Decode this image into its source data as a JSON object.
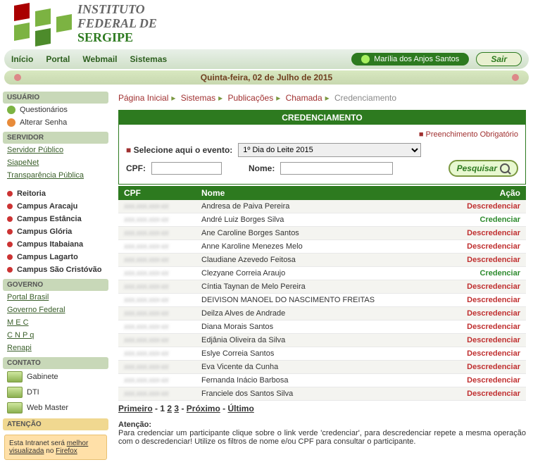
{
  "institute": {
    "line1": "INSTITUTO",
    "line2": "FEDERAL DE",
    "line3": "SERGIPE"
  },
  "topnav": {
    "inicio": "Início",
    "portal": "Portal",
    "webmail": "Webmail",
    "sistemas": "Sistemas"
  },
  "user": {
    "name": "Marília dos Anjos Santos",
    "logout": "Sair"
  },
  "date": "Quinta-feira, 02 de Julho de 2015",
  "sidebar": {
    "usuario_head": "USUÁRIO",
    "questionarios": "Questionários",
    "alterar_senha": "Alterar Senha",
    "servidor_head": "SERVIDOR",
    "servidor_links": [
      "Servidor Público",
      "SiapeNet",
      "Transparência Pública"
    ],
    "campi": [
      "Reitoria",
      "Campus Aracaju",
      "Campus Estância",
      "Campus Glória",
      "Campus Itabaiana",
      "Campus Lagarto",
      "Campus São Cristóvão"
    ],
    "governo_head": "GOVERNO",
    "governo_links": [
      "Portal Brasil",
      "Governo Federal",
      "M E C",
      "C N P q",
      "Renapi"
    ],
    "contato_head": "CONTATO",
    "contatos": [
      "Gabinete",
      "DTI",
      "Web Master"
    ],
    "atencao_head": "ATENÇÃO",
    "atencao_text": "Esta Intranet será ",
    "atencao_link": "melhor visualizada",
    "atencao_text2": " no ",
    "atencao_ff": "Firefox"
  },
  "breadcrumb": {
    "home": "Página Inicial",
    "sistemas": "Sistemas",
    "publicacoes": "Publicações",
    "chamada": "Chamada",
    "credenciamento": "Credenciamento"
  },
  "panel": {
    "title": "CREDENCIAMENTO",
    "req": "Preenchimento Obrigatório",
    "evento_label": "Selecione aqui o evento:",
    "evento_value": "1º Dia do Leite 2015",
    "cpf_label": "CPF:",
    "nome_label": "Nome:",
    "pesquisar": "Pesquisar",
    "col_cpf": "CPF",
    "col_nome": "Nome",
    "col_acao": "Ação",
    "act_d": "Descredenciar",
    "act_c": "Credenciar"
  },
  "rows": [
    {
      "cpf": "xxx.xxx.xxx-xx",
      "nome": "Andresa de Paiva Pereira",
      "action": "d"
    },
    {
      "cpf": "xxx.xxx.xxx-xx",
      "nome": "André Luiz Borges Silva",
      "action": "c"
    },
    {
      "cpf": "xxx.xxx.xxx-xx",
      "nome": "Ane Caroline Borges Santos",
      "action": "d"
    },
    {
      "cpf": "xxx.xxx.xxx-xx",
      "nome": "Anne Karoline Menezes Melo",
      "action": "d"
    },
    {
      "cpf": "xxx.xxx.xxx-xx",
      "nome": "Claudiane Azevedo Feitosa",
      "action": "d"
    },
    {
      "cpf": "xxx.xxx.xxx-xx",
      "nome": "Clezyane Correia Araujo",
      "action": "c"
    },
    {
      "cpf": "xxx.xxx.xxx-xx",
      "nome": "Cíntia Taynan de Melo Pereira",
      "action": "d"
    },
    {
      "cpf": "xxx.xxx.xxx-xx",
      "nome": "DEIVISON MANOEL DO NASCIMENTO FREITAS",
      "action": "d"
    },
    {
      "cpf": "xxx.xxx.xxx-xx",
      "nome": "Deilza Alves de Andrade",
      "action": "d"
    },
    {
      "cpf": "xxx.xxx.xxx-xx",
      "nome": "Diana Morais Santos",
      "action": "d"
    },
    {
      "cpf": "xxx.xxx.xxx-xx",
      "nome": "Edjânia Oliveira da Silva",
      "action": "d"
    },
    {
      "cpf": "xxx.xxx.xxx-xx",
      "nome": "Eslye Correia Santos",
      "action": "d"
    },
    {
      "cpf": "xxx.xxx.xxx-xx",
      "nome": "Eva Vicente da Cunha",
      "action": "d"
    },
    {
      "cpf": "xxx.xxx.xxx-xx",
      "nome": "Fernanda Inácio Barbosa",
      "action": "d"
    },
    {
      "cpf": "xxx.xxx.xxx-xx",
      "nome": "Franciele dos Santos Silva",
      "action": "d"
    }
  ],
  "pager": {
    "primeiro": "Primeiro",
    "p1": "1",
    "p2": "2",
    "p3": "3",
    "proximo": "Próximo",
    "ultimo": "Último"
  },
  "note": {
    "head": "Atenção:",
    "body": "Para credenciar um participante clique sobre o link verde 'credenciar', para descredenciar repete a mesma operação com o descredenciar! Utilize os filtros de nome e/ou CPF para consultar o participante."
  }
}
